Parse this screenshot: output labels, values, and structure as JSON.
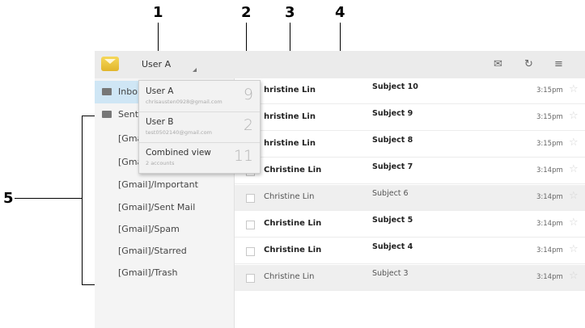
{
  "callouts": [
    "1",
    "2",
    "3",
    "4",
    "5"
  ],
  "header": {
    "account_label": "User A"
  },
  "actionbar_icons": [
    "compose-icon",
    "refresh-icon",
    "menu-icon"
  ],
  "folders": [
    {
      "label": "Inbox",
      "selected": true,
      "icon": "inbox-icon"
    },
    {
      "label": "Sent",
      "icon": "sent-icon"
    },
    {
      "label": "[Gmail]/All Mail"
    },
    {
      "label": "[Gmail]/Drafts"
    },
    {
      "label": "[Gmail]/Important"
    },
    {
      "label": "[Gmail]/Sent Mail"
    },
    {
      "label": "[Gmail]/Spam"
    },
    {
      "label": "[Gmail]/Starred"
    },
    {
      "label": "[Gmail]/Trash"
    }
  ],
  "folders_visible": [
    "Inbo",
    "Sent",
    "[Gma",
    "[Gma",
    "[Gmail]/Important",
    "[Gmail]/Sent Mail",
    "[Gmail]/Spam",
    "[Gmail]/Starred",
    "[Gmail]/Trash"
  ],
  "messages": [
    {
      "sender": "Christine Lin",
      "sender_visible": "hristine Lin",
      "subject": "Subject 10",
      "time": "3:15pm",
      "unread": true
    },
    {
      "sender": "Christine Lin",
      "sender_visible": "hristine Lin",
      "subject": "Subject 9",
      "time": "3:15pm",
      "unread": true
    },
    {
      "sender": "Christine Lin",
      "sender_visible": "hristine Lin",
      "subject": "Subject 8",
      "time": "3:15pm",
      "unread": true
    },
    {
      "sender": "Christine Lin",
      "subject": "Subject 7",
      "time": "3:14pm",
      "unread": true
    },
    {
      "sender": "Christine Lin",
      "subject": "Subject 6",
      "time": "3:14pm",
      "unread": false
    },
    {
      "sender": "Christine Lin",
      "subject": "Subject 5",
      "time": "3:14pm",
      "unread": true
    },
    {
      "sender": "Christine Lin",
      "subject": "Subject 4",
      "time": "3:14pm",
      "unread": true
    },
    {
      "sender": "Christine Lin",
      "subject": "Subject 3",
      "time": "3:14pm",
      "unread": false
    }
  ],
  "account_dropdown": [
    {
      "name": "User A",
      "email": "chrisausten0928@gmail.com",
      "count": "9"
    },
    {
      "name": "User B",
      "email": "test0502140@gmail.com",
      "count": "2"
    },
    {
      "name": "Combined view",
      "email": "2 accounts",
      "count": "11"
    }
  ]
}
